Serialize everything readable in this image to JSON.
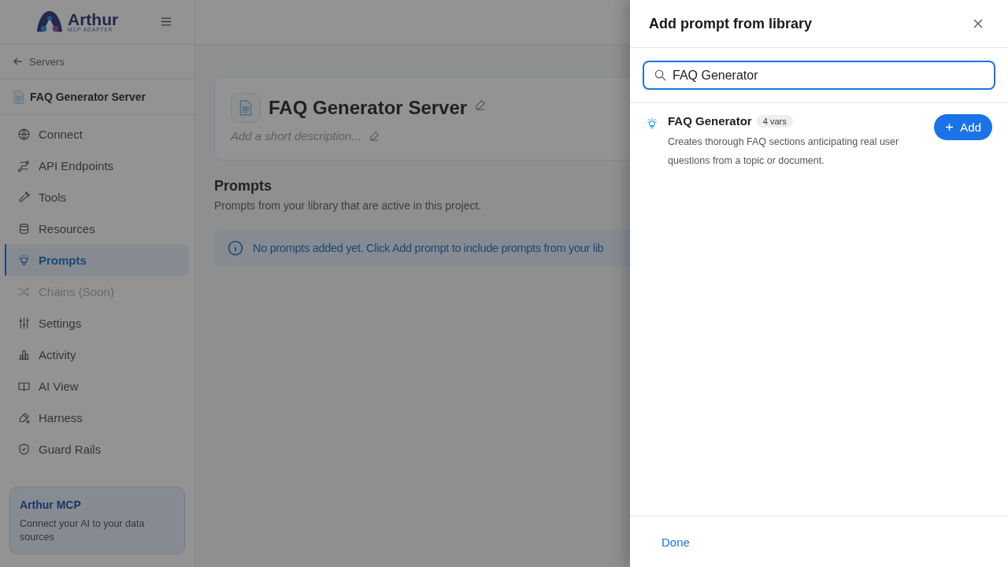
{
  "logo": {
    "name": "Arthur",
    "tagline": "MCP ADAPTER"
  },
  "sidebar": {
    "back_link": "Servers",
    "server_name": "FAQ Generator Server",
    "items": [
      {
        "label": "Connect",
        "selected": false,
        "disabled": false
      },
      {
        "label": "API Endpoints",
        "selected": false,
        "disabled": false
      },
      {
        "label": "Tools",
        "selected": false,
        "disabled": false
      },
      {
        "label": "Resources",
        "selected": false,
        "disabled": false
      },
      {
        "label": "Prompts",
        "selected": true,
        "disabled": false
      },
      {
        "label": "Chains (Soon)",
        "selected": false,
        "disabled": true
      },
      {
        "label": "Settings",
        "selected": false,
        "disabled": false
      },
      {
        "label": "Activity",
        "selected": false,
        "disabled": false
      },
      {
        "label": "AI View",
        "selected": false,
        "disabled": false
      },
      {
        "label": "Harness",
        "selected": false,
        "disabled": false
      },
      {
        "label": "Guard Rails",
        "selected": false,
        "disabled": false
      }
    ],
    "promo": {
      "title": "Arthur MCP",
      "text": "Connect your AI to your data sources"
    }
  },
  "main": {
    "title": "FAQ Generator Server",
    "description_placeholder": "Add a short description...",
    "section_title": "Prompts",
    "section_subtitle": "Prompts from your library that are active in this project.",
    "empty_notice": "No prompts added yet. Click Add prompt to include prompts from your lib"
  },
  "drawer": {
    "title": "Add prompt from library",
    "search": {
      "value": "FAQ Generator"
    },
    "results": [
      {
        "name": "FAQ Generator",
        "badge": "4 vars",
        "description": "Creates thorough FAQ sections anticipating real user questions from a topic or document.",
        "action": "Add"
      }
    ],
    "done_button": "Done"
  }
}
